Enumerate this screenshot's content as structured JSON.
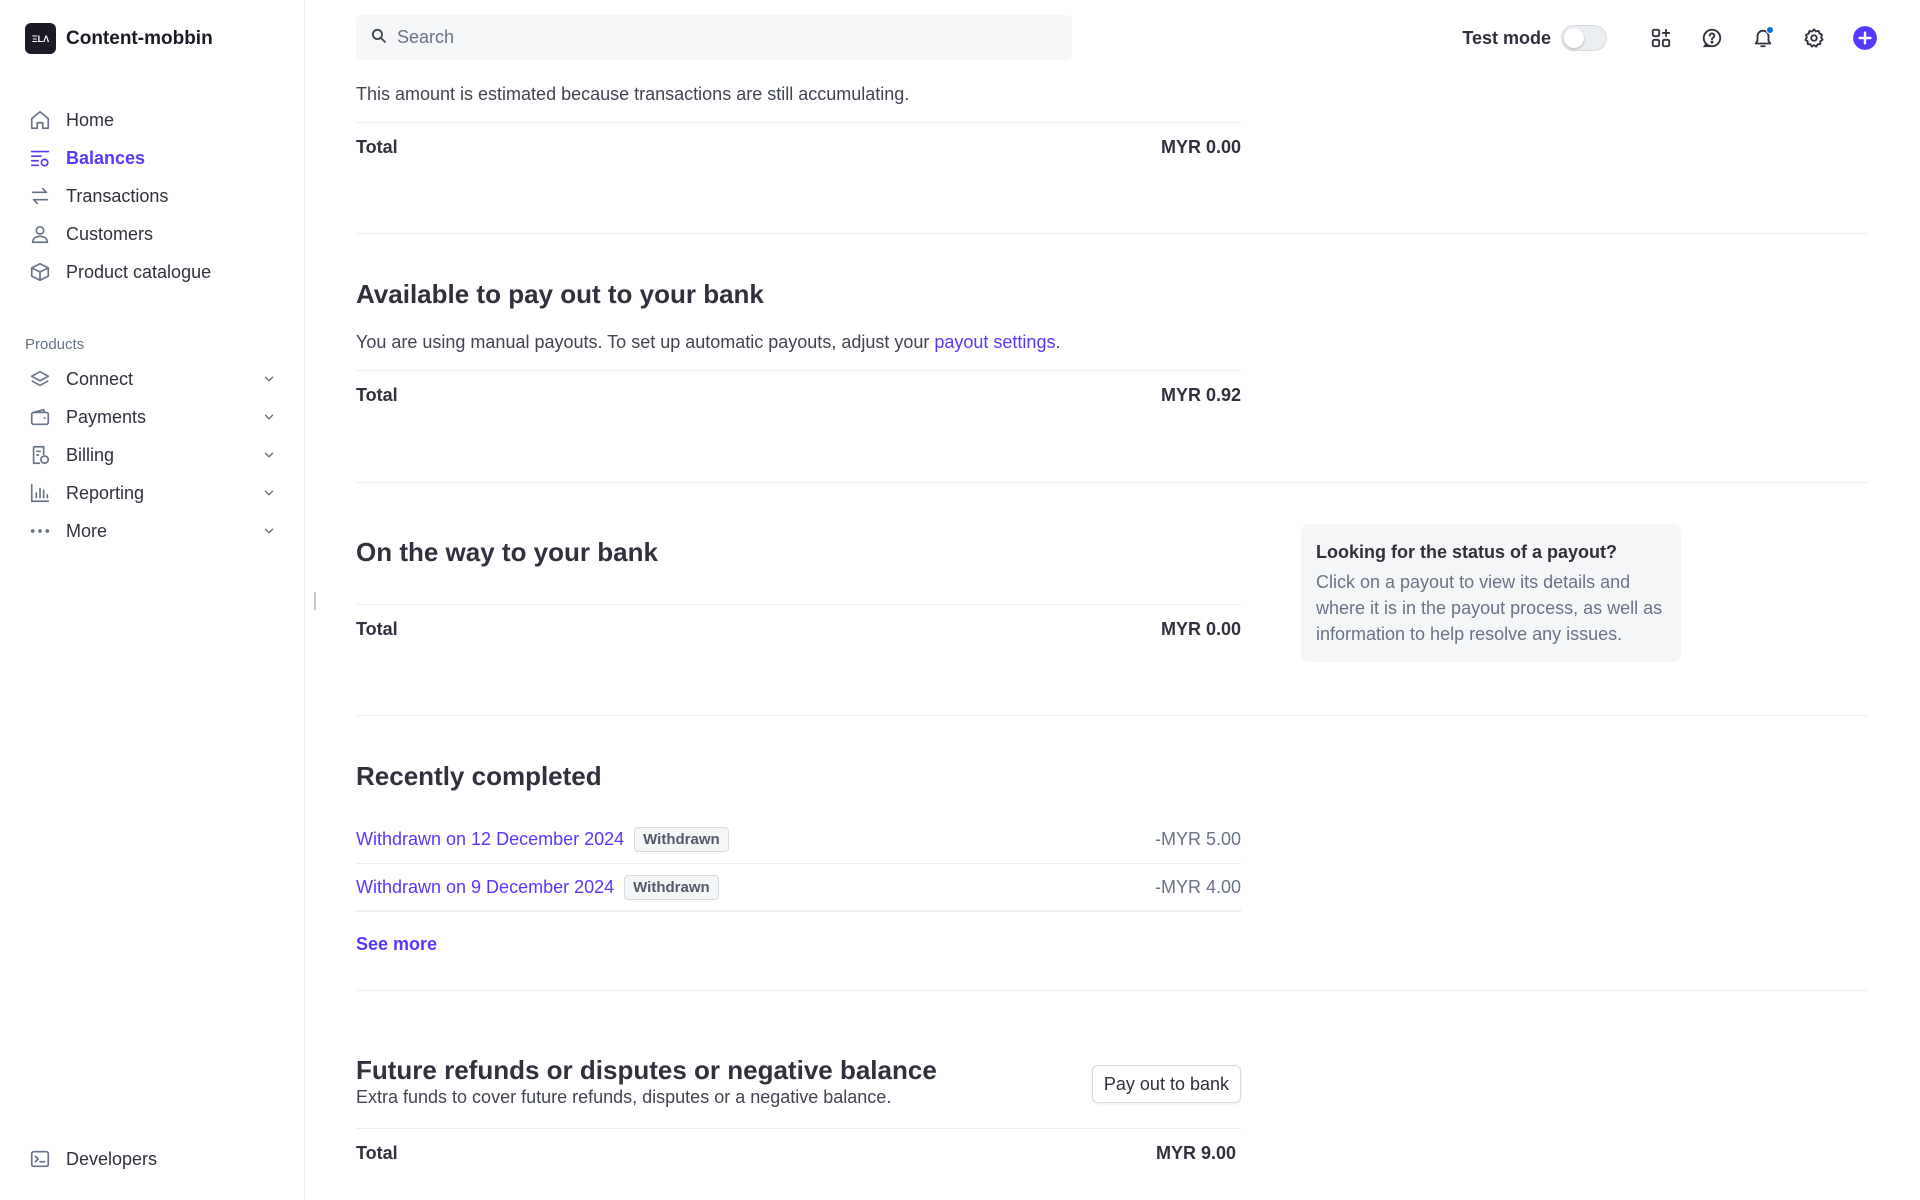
{
  "brand": {
    "logo_text": "ΞLΛ",
    "name": "Content-mobbin"
  },
  "nav": {
    "primary": [
      {
        "label": "Home",
        "icon": "home-icon",
        "active": false
      },
      {
        "label": "Balances",
        "icon": "balances-icon",
        "active": true
      },
      {
        "label": "Transactions",
        "icon": "transactions-icon",
        "active": false
      },
      {
        "label": "Customers",
        "icon": "customer-icon",
        "active": false
      },
      {
        "label": "Product catalogue",
        "icon": "product-box-icon",
        "active": false
      }
    ],
    "products_label": "Products",
    "products": [
      {
        "label": "Connect",
        "icon": "connect-layers-icon"
      },
      {
        "label": "Payments",
        "icon": "wallet-icon"
      },
      {
        "label": "Billing",
        "icon": "billing-icon"
      },
      {
        "label": "Reporting",
        "icon": "bar-chart-icon"
      },
      {
        "label": "More",
        "icon": "more-dots-icon"
      }
    ],
    "developers": {
      "label": "Developers",
      "icon": "terminal-icon"
    }
  },
  "search": {
    "placeholder": "Search",
    "value": ""
  },
  "topbar": {
    "test_mode_label": "Test mode",
    "test_mode_on": false,
    "icons": [
      "apps-add-icon",
      "help-icon",
      "bell-icon",
      "settings-gear-icon",
      "create-plus-icon"
    ],
    "accent": "#533afd",
    "notification_dot": "#0570de"
  },
  "incoming": {
    "note": "This amount is estimated because transactions are still accumulating.",
    "total_label": "Total",
    "total_value": "MYR 0.00"
  },
  "available": {
    "title": "Available to pay out to your bank",
    "text_before": "You are using manual payouts. To set up automatic payouts, adjust your ",
    "link": "payout settings",
    "text_after": ".",
    "total_label": "Total",
    "total_value": "MYR 0.92"
  },
  "on_the_way": {
    "title": "On the way to your bank",
    "total_label": "Total",
    "total_value": "MYR 0.00"
  },
  "info_card": {
    "title": "Looking for the status of a payout?",
    "text": "Click on a payout to view its details and where it is in the payout process, as well as information to help resolve any issues."
  },
  "recently_completed": {
    "title": "Recently completed",
    "items": [
      {
        "label": "Withdrawn on 12 December 2024",
        "badge": "Withdrawn",
        "amount": "-MYR 5.00"
      },
      {
        "label": "Withdrawn on 9 December 2024",
        "badge": "Withdrawn",
        "amount": "-MYR 4.00"
      }
    ],
    "see_more": "See more"
  },
  "future": {
    "title": "Future refunds or disputes or negative balance",
    "subtitle": "Extra funds to cover future refunds, disputes or a negative balance.",
    "button": "Pay out to bank",
    "total_label": "Total",
    "total_value": "MYR 9.00"
  }
}
